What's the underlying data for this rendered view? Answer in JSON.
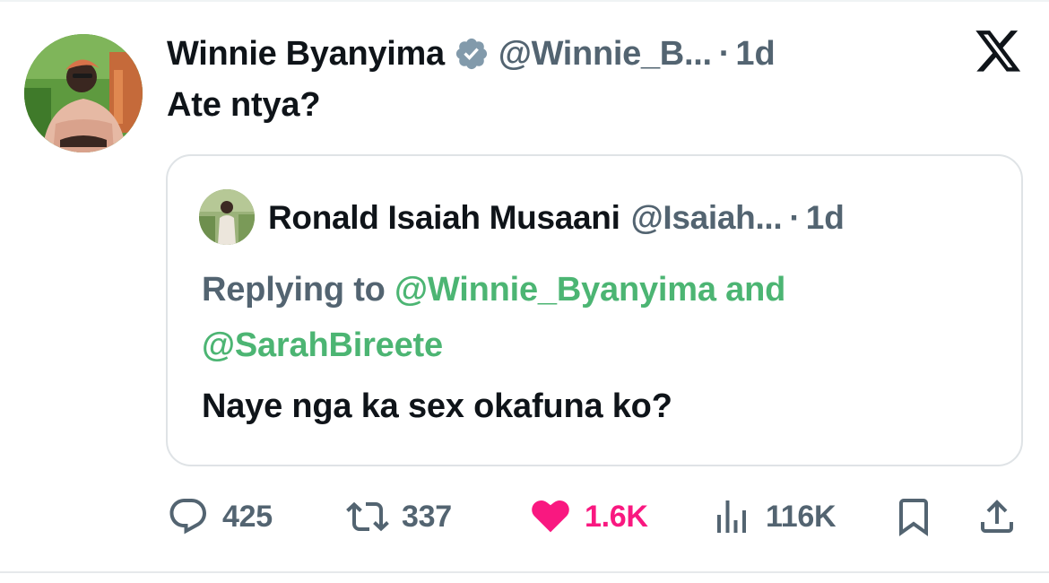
{
  "tweet": {
    "author_name": "Winnie Byanyima",
    "author_handle": "@Winnie_B...",
    "separator": "·",
    "time": "1d",
    "text": "Ate ntya?",
    "verified_icon": "verified-badge-icon",
    "brand_icon": "x-logo-icon"
  },
  "quote": {
    "author_name": "Ronald Isaiah Musaani",
    "author_handle": "@Isaiah...",
    "separator": "·",
    "time": "1d",
    "replying_prefix": "Replying to ",
    "mention_1": "@Winnie_Byanyima",
    "mention_join": " and ",
    "mention_2": "@SarahBireete",
    "text": "Naye nga ka sex okafuna ko?"
  },
  "actions": {
    "replies": "425",
    "reposts": "337",
    "likes": "1.6K",
    "views": "116K",
    "icons": [
      "reply-icon",
      "repost-icon",
      "like-icon",
      "views-icon",
      "bookmark-icon",
      "share-icon"
    ]
  },
  "colors": {
    "text": "#0f1419",
    "secondary": "#536471",
    "mention": "#4cb573",
    "like": "#f91880",
    "verified": "#829aab",
    "border": "#dfe3e6"
  }
}
